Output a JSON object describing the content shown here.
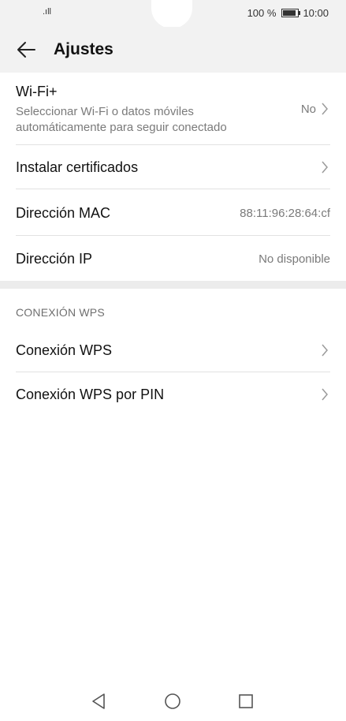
{
  "status_bar": {
    "signal": ".ıll",
    "battery_percent": "100 %",
    "time": "10:00"
  },
  "header": {
    "title": "Ajustes"
  },
  "rows": {
    "wifi_plus": {
      "label": "Wi-Fi+",
      "description_line1": "Seleccionar Wi-Fi o datos móviles",
      "description_line2": "automáticamente para seguir conectado",
      "value": "No"
    },
    "certificates": {
      "label": "Instalar certificados"
    },
    "mac": {
      "label": "Dirección MAC",
      "value": "88:11:96:28:64:cf"
    },
    "ip": {
      "label": "Dirección IP",
      "value": "No disponible"
    }
  },
  "wps_section": {
    "title": "CONEXIÓN WPS",
    "items": [
      {
        "label": "Conexión WPS"
      },
      {
        "label": "Conexión WPS por PIN"
      }
    ]
  },
  "icons": {
    "back": "arrow-left-icon",
    "chevron": "chevron-right-icon",
    "nav_back": "triangle-back-icon",
    "nav_home": "circle-home-icon",
    "nav_recent": "square-recents-icon"
  },
  "colors": {
    "header_bg": "#f2f2f2",
    "secondary_text": "#7a7a7a",
    "divider": "#e2e2e2"
  }
}
